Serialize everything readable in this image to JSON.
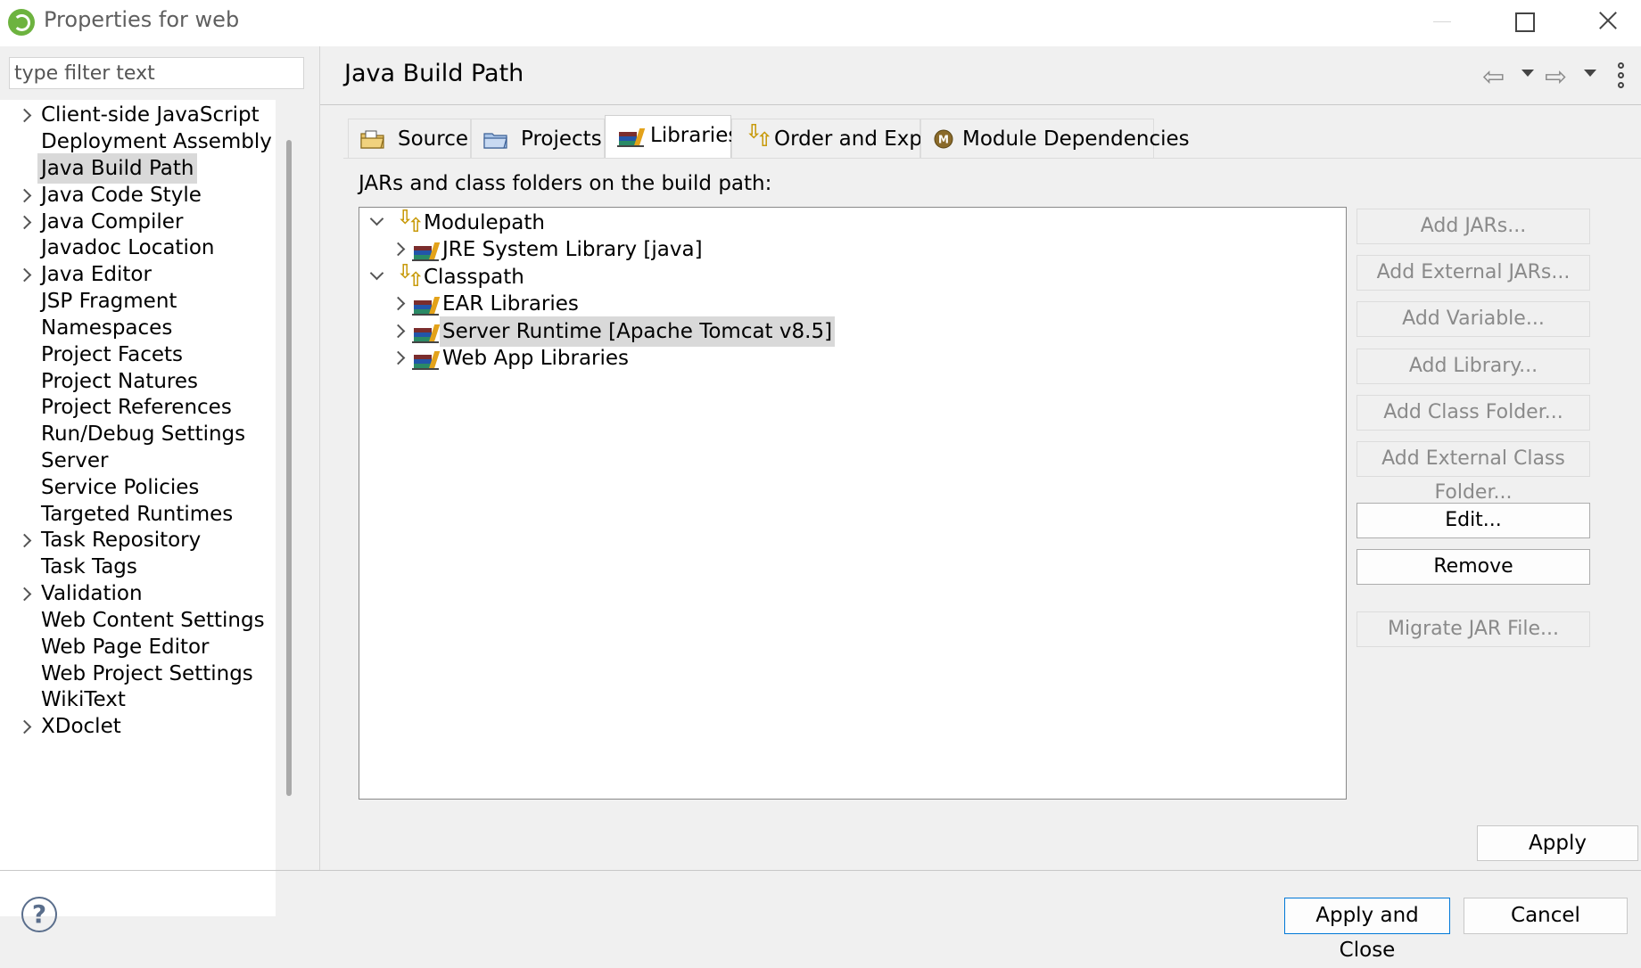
{
  "window": {
    "title": "Properties for web"
  },
  "filter": {
    "placeholder": "type filter text"
  },
  "nav": {
    "items": [
      {
        "label": "Client-side JavaScript"
      },
      {
        "label": "Deployment Assembly"
      },
      {
        "label": "Java Build Path"
      },
      {
        "label": "Java Code Style"
      },
      {
        "label": "Java Compiler"
      },
      {
        "label": "Javadoc Location"
      },
      {
        "label": "Java Editor"
      },
      {
        "label": "JSP Fragment"
      },
      {
        "label": "Namespaces"
      },
      {
        "label": "Project Facets"
      },
      {
        "label": "Project Natures"
      },
      {
        "label": "Project References"
      },
      {
        "label": "Run/Debug Settings"
      },
      {
        "label": "Server"
      },
      {
        "label": "Service Policies"
      },
      {
        "label": "Targeted Runtimes"
      },
      {
        "label": "Task Repository"
      },
      {
        "label": "Task Tags"
      },
      {
        "label": "Validation"
      },
      {
        "label": "Web Content Settings"
      },
      {
        "label": "Web Page Editor"
      },
      {
        "label": "Web Project Settings"
      },
      {
        "label": "WikiText"
      },
      {
        "label": "XDoclet"
      }
    ]
  },
  "page": {
    "title": "Java Build Path"
  },
  "tabs": [
    {
      "label": "Source"
    },
    {
      "label": "Projects"
    },
    {
      "label": "Libraries"
    },
    {
      "label": "Order and Export"
    },
    {
      "label": "Module Dependencies"
    }
  ],
  "libraries": {
    "caption": "JARs and class folders on the build path:",
    "tree": [
      {
        "label": "Modulepath"
      },
      {
        "label": "JRE System Library [java]"
      },
      {
        "label": "Classpath"
      },
      {
        "label": "EAR Libraries"
      },
      {
        "label": "Server Runtime [Apache Tomcat v8.5]"
      },
      {
        "label": "Web App Libraries"
      }
    ],
    "buttons": {
      "add_jars": "Add JARs...",
      "add_external_jars": "Add External JARs...",
      "add_variable": "Add Variable...",
      "add_library": "Add Library...",
      "add_class_folder": "Add Class Folder...",
      "add_external_class_folder": "Add External Class Folder...",
      "edit": "Edit...",
      "remove": "Remove",
      "migrate_jar": "Migrate JAR File..."
    }
  },
  "footer": {
    "apply": "Apply",
    "apply_and_close": "Apply and Close",
    "cancel": "Cancel",
    "help_glyph": "?"
  },
  "icons": {
    "app": "spring-leaf-icon",
    "help": "help-icon",
    "back": "back-arrow-icon",
    "forward": "forward-arrow-icon",
    "menu": "view-menu-icon"
  },
  "colors": {
    "accent": "#0078d7",
    "selection": "#d9d9d9",
    "disabled_text": "#8a8a8a"
  }
}
